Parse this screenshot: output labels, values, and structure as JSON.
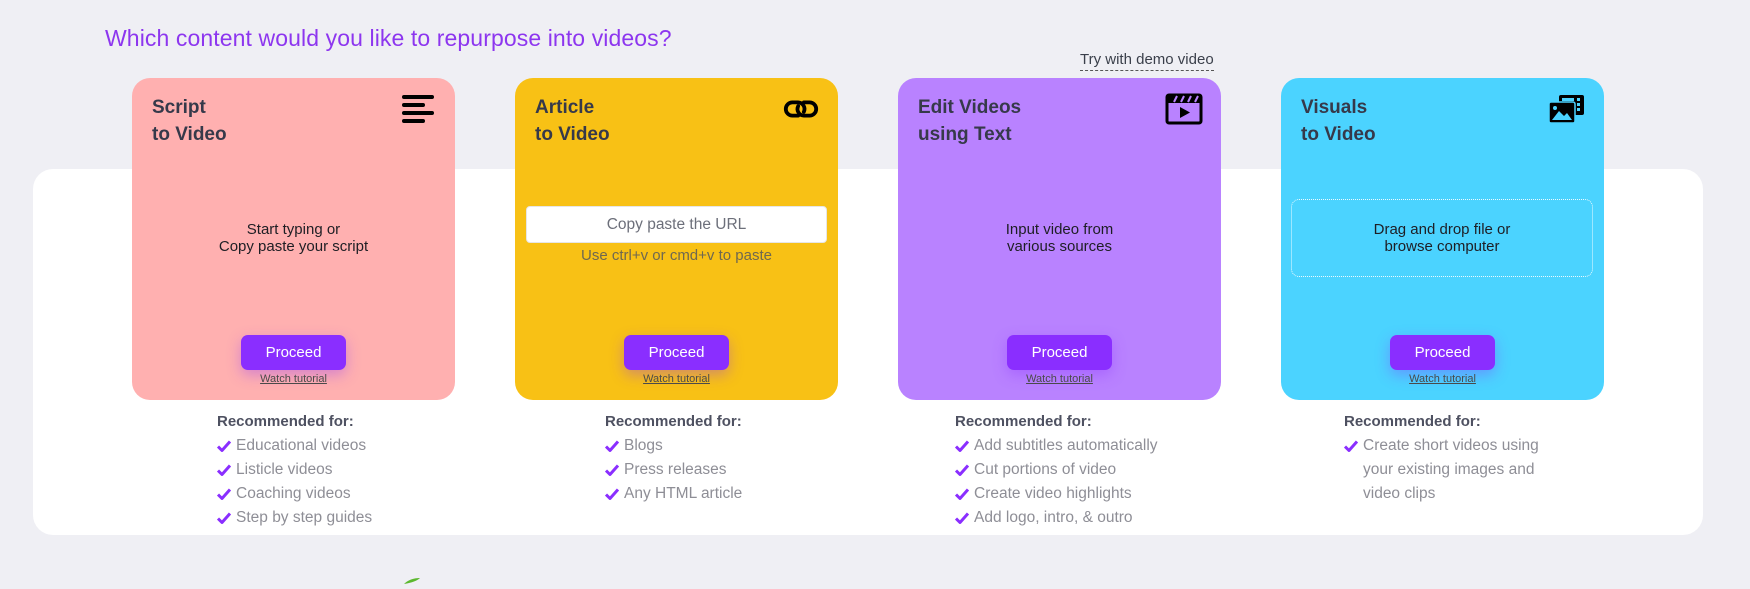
{
  "header": {
    "title": "Which content would you like to repurpose into videos?",
    "demo_link": "Try with demo video"
  },
  "colors": {
    "accent": "#8a2eff",
    "title": "#8d36ef",
    "background": "#efeff4",
    "panel": "#ffffff"
  },
  "cards": [
    {
      "id": "script-to-video",
      "title": "Script\nto Video",
      "icon": "align-left-lines-icon",
      "color": "#ffb0b0",
      "center_text": "Start typing or\nCopy paste your script",
      "proceed_label": "Proceed",
      "tutorial_label": "Watch tutorial",
      "recommended_heading": "Recommended for:",
      "recommended": [
        "Educational videos",
        "Listicle videos",
        "Coaching videos",
        "Step by step guides"
      ]
    },
    {
      "id": "article-to-video",
      "title": "Article\nto Video",
      "icon": "link-icon",
      "color": "#f8c115",
      "url_placeholder": "Copy paste the URL",
      "url_hint": "Use ctrl+v or cmd+v to paste",
      "proceed_label": "Proceed",
      "tutorial_label": "Watch tutorial",
      "recommended_heading": "Recommended for:",
      "recommended": [
        "Blogs",
        "Press releases",
        "Any HTML article"
      ]
    },
    {
      "id": "edit-videos-using-text",
      "title": "Edit Videos\nusing Text",
      "icon": "clapperboard-icon",
      "color": "#b982ff",
      "center_text": "Input video from\nvarious sources",
      "proceed_label": "Proceed",
      "tutorial_label": "Watch tutorial",
      "recommended_heading": "Recommended for:",
      "recommended": [
        "Add subtitles automatically",
        "Cut portions of video",
        "Create video highlights",
        "Add logo, intro, & outro"
      ]
    },
    {
      "id": "visuals-to-video",
      "title": "Visuals\nto Video",
      "icon": "images-film-icon",
      "color": "#4bd3ff",
      "drop_text": "Drag and drop file or\nbrowse computer",
      "proceed_label": "Proceed",
      "tutorial_label": "Watch tutorial",
      "recommended_heading": "Recommended for:",
      "recommended": [
        "Create short videos using\nyour existing images and\nvideo clips"
      ]
    }
  ]
}
